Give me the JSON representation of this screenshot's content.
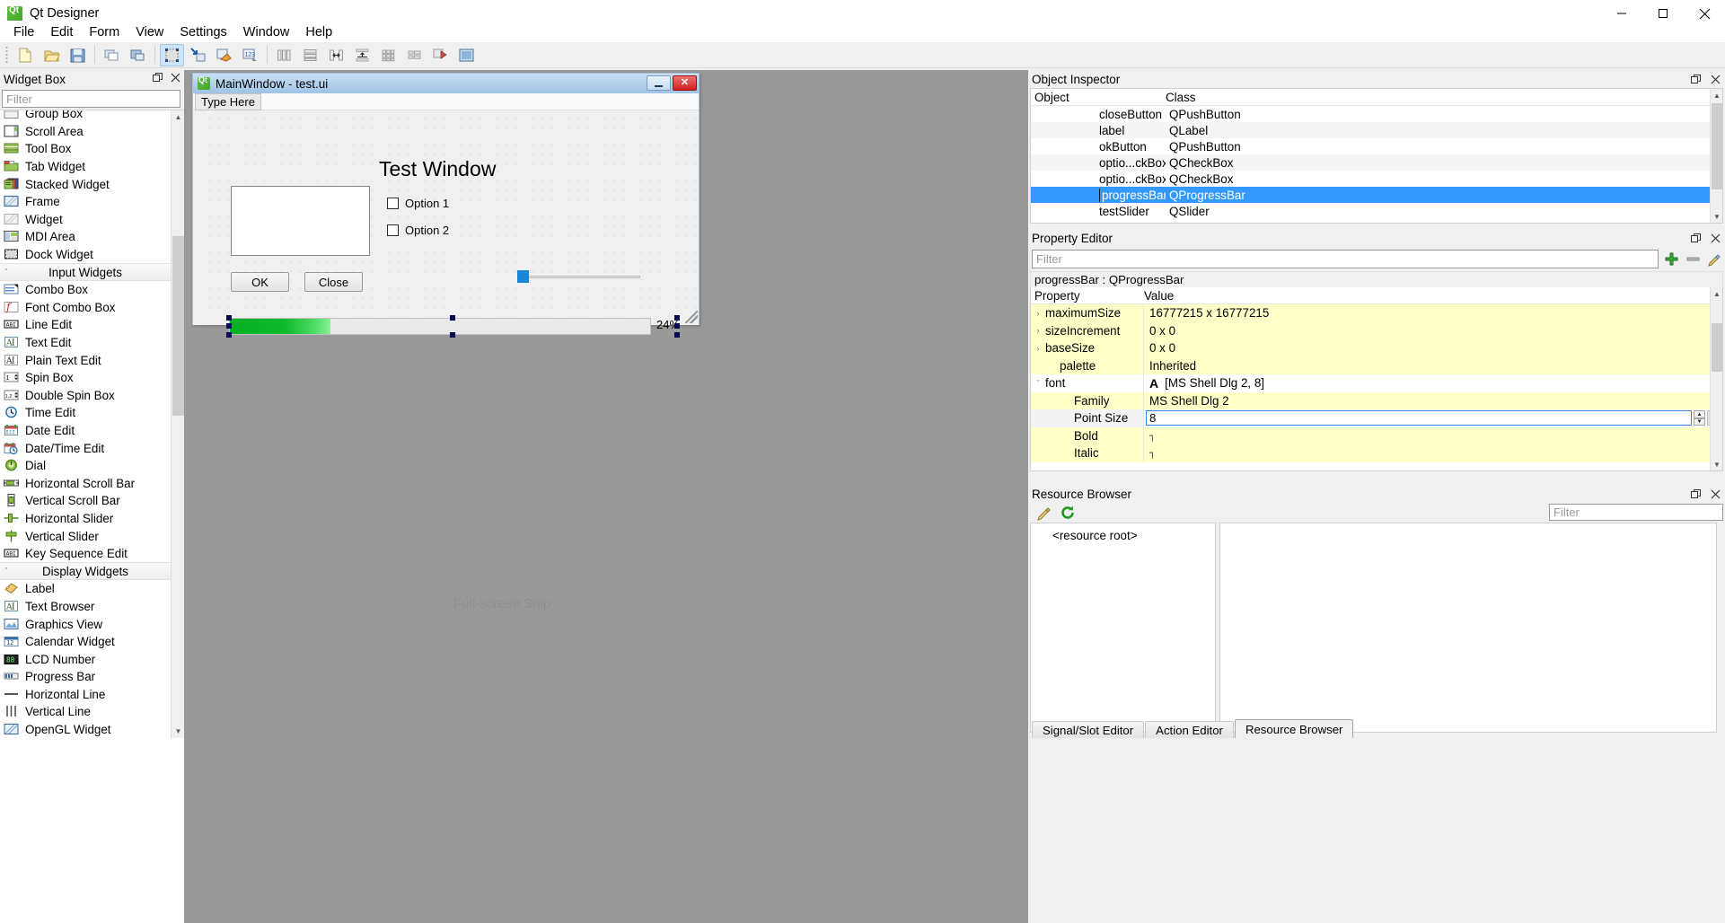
{
  "app": {
    "title": "Qt Designer",
    "icon": "qt-logo-icon"
  },
  "window_controls": {
    "minimize": "minimize-icon",
    "maximize": "maximize-icon",
    "close": "close-icon"
  },
  "menubar": {
    "items": [
      {
        "label": "File"
      },
      {
        "label": "Edit"
      },
      {
        "label": "Form"
      },
      {
        "label": "View"
      },
      {
        "label": "Settings"
      },
      {
        "label": "Window"
      },
      {
        "label": "Help"
      }
    ]
  },
  "toolbar": {
    "groups": [
      {
        "buttons": [
          {
            "name": "new-form-icon"
          },
          {
            "name": "open-form-icon"
          },
          {
            "name": "save-form-icon"
          }
        ]
      },
      {
        "buttons": [
          {
            "name": "undo-icon"
          },
          {
            "name": "redo-icon"
          }
        ]
      },
      {
        "buttons": [
          {
            "name": "edit-widgets-icon",
            "active": true
          },
          {
            "name": "edit-signals-slots-icon",
            "active": false
          },
          {
            "name": "edit-buddies-icon",
            "active": false
          },
          {
            "name": "edit-tab-order-icon",
            "active": false
          }
        ]
      },
      {
        "buttons": [
          {
            "name": "layout-horizontally-icon"
          },
          {
            "name": "layout-vertically-icon"
          },
          {
            "name": "layout-in-splitter-horizontal-icon"
          },
          {
            "name": "layout-in-splitter-vertical-icon"
          },
          {
            "name": "layout-in-grid-icon"
          },
          {
            "name": "layout-in-form-icon"
          },
          {
            "name": "break-layout-icon"
          },
          {
            "name": "adjust-size-icon"
          }
        ]
      }
    ]
  },
  "widget_box": {
    "title": "Widget Box",
    "float_icon": "float-dock-icon",
    "close_icon": "close-dock-icon",
    "filter_placeholder": "Filter",
    "items": [
      {
        "label": "Group Box",
        "icon": "group-box-icon",
        "type": "widget"
      },
      {
        "label": "Scroll Area",
        "icon": "scroll-area-icon",
        "type": "widget"
      },
      {
        "label": "Tool Box",
        "icon": "tool-box-icon",
        "type": "widget"
      },
      {
        "label": "Tab Widget",
        "icon": "tab-widget-icon",
        "type": "widget"
      },
      {
        "label": "Stacked Widget",
        "icon": "stacked-widget-icon",
        "type": "widget"
      },
      {
        "label": "Frame",
        "icon": "frame-icon",
        "type": "widget"
      },
      {
        "label": "Widget",
        "icon": "widget-icon",
        "type": "widget"
      },
      {
        "label": "MDI Area",
        "icon": "mdi-area-icon",
        "type": "widget"
      },
      {
        "label": "Dock Widget",
        "icon": "dock-widget-icon",
        "type": "widget"
      },
      {
        "label": "Input Widgets",
        "icon": "category-collapse-icon",
        "type": "category"
      },
      {
        "label": "Combo Box",
        "icon": "combo-box-icon",
        "type": "widget"
      },
      {
        "label": "Font Combo Box",
        "icon": "font-combo-box-icon",
        "type": "widget"
      },
      {
        "label": "Line Edit",
        "icon": "line-edit-icon",
        "type": "widget"
      },
      {
        "label": "Text Edit",
        "icon": "text-edit-icon",
        "type": "widget"
      },
      {
        "label": "Plain Text Edit",
        "icon": "plain-text-edit-icon",
        "type": "widget"
      },
      {
        "label": "Spin Box",
        "icon": "spin-box-icon",
        "type": "widget"
      },
      {
        "label": "Double Spin Box",
        "icon": "double-spin-box-icon",
        "type": "widget"
      },
      {
        "label": "Time Edit",
        "icon": "time-edit-icon",
        "type": "widget"
      },
      {
        "label": "Date Edit",
        "icon": "date-edit-icon",
        "type": "widget"
      },
      {
        "label": "Date/Time Edit",
        "icon": "date-time-edit-icon",
        "type": "widget"
      },
      {
        "label": "Dial",
        "icon": "dial-icon",
        "type": "widget"
      },
      {
        "label": "Horizontal Scroll Bar",
        "icon": "horizontal-scroll-bar-icon",
        "type": "widget"
      },
      {
        "label": "Vertical Scroll Bar",
        "icon": "vertical-scroll-bar-icon",
        "type": "widget"
      },
      {
        "label": "Horizontal Slider",
        "icon": "horizontal-slider-icon",
        "type": "widget"
      },
      {
        "label": "Vertical Slider",
        "icon": "vertical-slider-icon",
        "type": "widget"
      },
      {
        "label": "Key Sequence Edit",
        "icon": "key-sequence-edit-icon",
        "type": "widget"
      },
      {
        "label": "Display Widgets",
        "icon": "category-collapse-icon",
        "type": "category"
      },
      {
        "label": "Label",
        "icon": "label-icon",
        "type": "widget"
      },
      {
        "label": "Text Browser",
        "icon": "text-browser-icon",
        "type": "widget"
      },
      {
        "label": "Graphics View",
        "icon": "graphics-view-icon",
        "type": "widget"
      },
      {
        "label": "Calendar Widget",
        "icon": "calendar-widget-icon",
        "type": "widget"
      },
      {
        "label": "LCD Number",
        "icon": "lcd-number-icon",
        "type": "widget"
      },
      {
        "label": "Progress Bar",
        "icon": "progress-bar-icon",
        "type": "widget"
      },
      {
        "label": "Horizontal Line",
        "icon": "horizontal-line-icon",
        "type": "widget"
      },
      {
        "label": "Vertical Line",
        "icon": "vertical-line-icon",
        "type": "widget"
      },
      {
        "label": "OpenGL Widget",
        "icon": "opengl-widget-icon",
        "type": "widget"
      }
    ]
  },
  "form": {
    "title": "MainWindow - test.ui",
    "icon": "qt-form-icon",
    "minimize_label": "minimize-icon",
    "close_label": "✕",
    "menubar_placeholder": "Type Here",
    "heading": "Test Window",
    "checkboxes": [
      {
        "label": "Option 1",
        "checked": false
      },
      {
        "label": "Option 2",
        "checked": false
      }
    ],
    "buttons": [
      {
        "label": "OK"
      },
      {
        "label": "Close"
      }
    ],
    "progress": {
      "percent": 24,
      "text": "24%"
    },
    "slider": {
      "value": 0
    }
  },
  "canvas": {
    "watermark": "Full-screen Snip"
  },
  "object_inspector": {
    "title": "Object Inspector",
    "float_icon": "float-dock-icon",
    "close_icon": "close-dock-icon",
    "columns": [
      "Object",
      "Class"
    ],
    "rows": [
      {
        "object": "closeButton",
        "class": "QPushButton",
        "selected": false
      },
      {
        "object": "label",
        "class": "QLabel",
        "selected": false
      },
      {
        "object": "okButton",
        "class": "QPushButton",
        "selected": false
      },
      {
        "object": "optio...ckBox",
        "class": "QCheckBox",
        "selected": false
      },
      {
        "object": "optio...ckBox",
        "class": "QCheckBox",
        "selected": false
      },
      {
        "object": "progressBar",
        "class": "QProgressBar",
        "selected": true
      },
      {
        "object": "testSlider",
        "class": "QSlider",
        "selected": false
      }
    ]
  },
  "property_editor": {
    "title": "Property Editor",
    "float_icon": "float-dock-icon",
    "close_icon": "close-dock-icon",
    "filter_placeholder": "Filter",
    "add_icon": "add-dynamic-property-icon",
    "remove_icon": "remove-dynamic-property-icon",
    "config_icon": "configure-property-editor-icon",
    "object_header": "progressBar : QProgressBar",
    "columns": [
      "Property",
      "Value"
    ],
    "rows": [
      {
        "name": "maximumSize",
        "value": "16777215 x 16777215",
        "expander": "collapsed",
        "indent": 0,
        "shade": "yellow",
        "kind": "text"
      },
      {
        "name": "sizeIncrement",
        "value": "0 x 0",
        "expander": "collapsed",
        "indent": 0,
        "shade": "yellow",
        "kind": "text"
      },
      {
        "name": "baseSize",
        "value": "0 x 0",
        "expander": "collapsed",
        "indent": 0,
        "shade": "yellow",
        "kind": "text"
      },
      {
        "name": "palette",
        "value": "Inherited",
        "expander": "none",
        "indent": 1,
        "shade": "yellow",
        "kind": "text"
      },
      {
        "name": "font",
        "value": "[MS Shell Dlg 2, 8]",
        "expander": "expanded",
        "indent": 0,
        "shade": "white",
        "kind": "font"
      },
      {
        "name": "Family",
        "value": "MS Shell Dlg 2",
        "expander": "none",
        "indent": 2,
        "shade": "yellow",
        "kind": "text"
      },
      {
        "name": "Point Size",
        "value": "8",
        "expander": "none",
        "indent": 2,
        "shade": "greyhdr",
        "kind": "spin"
      },
      {
        "name": "Bold",
        "value": "",
        "expander": "none",
        "indent": 2,
        "shade": "yellow",
        "kind": "check"
      },
      {
        "name": "Italic",
        "value": "",
        "expander": "none",
        "indent": 2,
        "shade": "yellow",
        "kind": "check"
      }
    ]
  },
  "resource_browser": {
    "title": "Resource Browser",
    "float_icon": "float-dock-icon",
    "close_icon": "close-dock-icon",
    "edit_icon": "edit-resources-icon",
    "reload_icon": "reload-resources-icon",
    "filter_placeholder": "Filter",
    "root_label": "<resource root>"
  },
  "bottom_tabs": [
    {
      "label": "Signal/Slot Editor",
      "active": false
    },
    {
      "label": "Action Editor",
      "active": false
    },
    {
      "label": "Resource Browser",
      "active": true
    }
  ],
  "colors": {
    "accent_blue": "#3399ff",
    "canvas_grey": "#999999",
    "progress_green": "#0fba2c",
    "slider_blue": "#1b87d8",
    "property_yellow": "#ffffc8",
    "selection_handle": "#0a0a50"
  }
}
